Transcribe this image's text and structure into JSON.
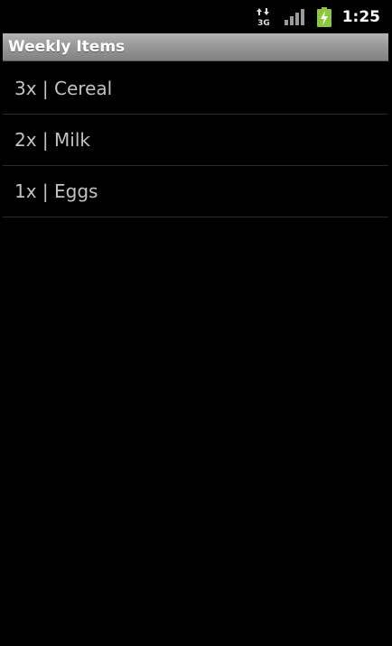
{
  "status_bar": {
    "network_type": "3G",
    "network_icon": "3g-data-icon",
    "signal_icon": "signal-strength-icon",
    "battery_icon": "battery-charging-icon",
    "time": "1:25",
    "battery_color": "#8dc63f"
  },
  "title_bar": {
    "title": "Weekly Items"
  },
  "items": [
    {
      "label": "3x | Cereal"
    },
    {
      "label": "2x | Milk"
    },
    {
      "label": "1x | Eggs"
    }
  ],
  "colors": {
    "background": "#000000",
    "title_bar": "#9a9a9a",
    "item_text": "#c2c2c2",
    "divider": "#2b2b2b"
  }
}
